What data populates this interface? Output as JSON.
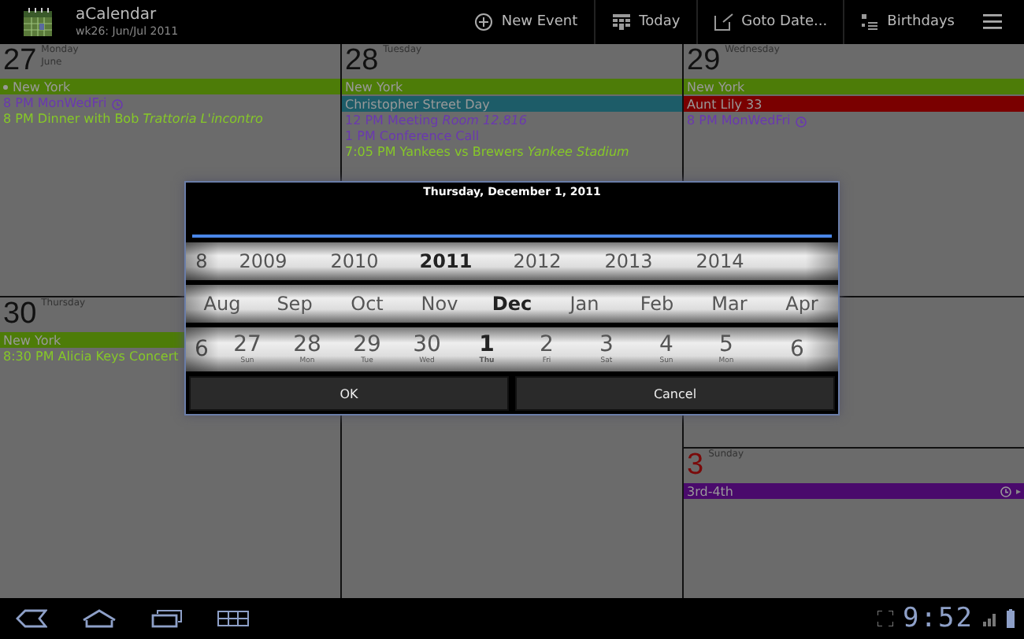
{
  "app": {
    "title": "aCalendar",
    "subtitle": "wk26: Jun/Jul 2011"
  },
  "actions": [
    {
      "label": "New Event"
    },
    {
      "label": "Today"
    },
    {
      "label": "Goto Date..."
    },
    {
      "label": "Birthdays"
    }
  ],
  "days": [
    {
      "number": "27",
      "weekday": "Monday",
      "month": "June",
      "weekend": false,
      "events": [
        {
          "kind": "bar",
          "text": "New York",
          "color": "#4d7c08",
          "continued": true
        },
        {
          "kind": "timed",
          "text": "8 PM MonWedFri",
          "color": "#6a38b0",
          "icon": true
        },
        {
          "kind": "timed",
          "text": "8 PM Dinner with Bob *Trattoria L'incontro*",
          "color": "#86c828"
        }
      ]
    },
    {
      "number": "28",
      "weekday": "Tuesday",
      "weekend": false,
      "events": [
        {
          "kind": "bar",
          "text": "New York",
          "color": "#4d7c08"
        },
        {
          "kind": "bar",
          "text": "Christopher Street Day",
          "color": "#1d5c68"
        },
        {
          "kind": "timed",
          "text": "12 PM Meeting *Room 12.816*",
          "color": "#6a38b0"
        },
        {
          "kind": "timed",
          "text": "1 PM Conference Call",
          "color": "#6a38b0"
        },
        {
          "kind": "timed",
          "text": "7:05 PM Yankees vs Brewers *Yankee Stadium*",
          "color": "#86c828"
        }
      ]
    },
    {
      "number": "29",
      "weekday": "Wednesday",
      "weekend": false,
      "events": [
        {
          "kind": "bar",
          "text": "New York",
          "color": "#4d7c08"
        },
        {
          "kind": "bar",
          "text": "Aunt Lily 33",
          "color": "#7a0000"
        },
        {
          "kind": "timed",
          "text": "8 PM MonWedFri",
          "color": "#6a38b0",
          "icon": true
        }
      ]
    },
    {
      "number": "30",
      "weekday": "Thursday",
      "weekend": false,
      "events": [
        {
          "kind": "bar",
          "text": "New York",
          "color": "#4d7c08"
        },
        {
          "kind": "timed",
          "text": "8:30 PM Alicia Keys Concert",
          "color": "#86c828"
        }
      ]
    },
    {
      "number": "3",
      "weekday": "Sunday",
      "weekend": true,
      "events": [
        {
          "kind": "bar",
          "text": "3rd-4th",
          "color": "#4a0a6c",
          "icon": true,
          "arrow": "▸"
        }
      ]
    }
  ],
  "picker": {
    "title": "Thursday, December 1, 2011",
    "years": [
      {
        "label": "8",
        "selected": false
      },
      {
        "label": "2009",
        "selected": false
      },
      {
        "label": "2010",
        "selected": false
      },
      {
        "label": "2011",
        "selected": true
      },
      {
        "label": "2012",
        "selected": false
      },
      {
        "label": "2013",
        "selected": false
      },
      {
        "label": "2014",
        "selected": false
      }
    ],
    "months": [
      {
        "label": "Aug",
        "selected": false
      },
      {
        "label": "Sep",
        "selected": false
      },
      {
        "label": "Oct",
        "selected": false
      },
      {
        "label": "Nov",
        "selected": false
      },
      {
        "label": "Dec",
        "selected": true
      },
      {
        "label": "Jan",
        "selected": false
      },
      {
        "label": "Feb",
        "selected": false
      },
      {
        "label": "Mar",
        "selected": false
      },
      {
        "label": "Apr",
        "selected": false
      }
    ],
    "days": [
      {
        "label": "6",
        "selected": false
      },
      {
        "label": "27",
        "weekday": "Sun",
        "selected": false
      },
      {
        "label": "28",
        "weekday": "Mon",
        "selected": false
      },
      {
        "label": "29",
        "weekday": "Tue",
        "selected": false
      },
      {
        "label": "30",
        "weekday": "Wed",
        "selected": false
      },
      {
        "label": "1",
        "weekday": "Thu",
        "selected": true
      },
      {
        "label": "2",
        "weekday": "Fri",
        "selected": false
      },
      {
        "label": "3",
        "weekday": "Sat",
        "selected": false
      },
      {
        "label": "4",
        "weekday": "Sun",
        "selected": false
      },
      {
        "label": "5",
        "weekday": "Mon",
        "selected": false
      },
      {
        "label": "6",
        "selected": false
      }
    ],
    "buttons": [
      "OK",
      "Cancel"
    ]
  },
  "statusbar": {
    "time": "9:52"
  }
}
